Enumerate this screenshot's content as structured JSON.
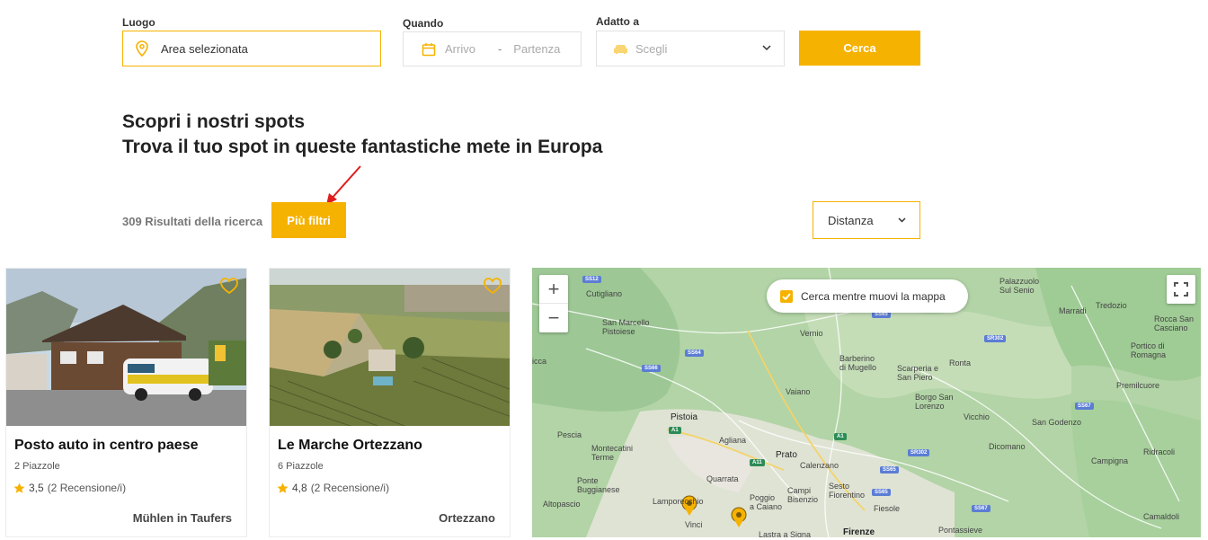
{
  "search": {
    "place_label": "Luogo",
    "place_value": "Area selezionata",
    "when_label": "Quando",
    "arrival_placeholder": "Arrivo",
    "separator": "-",
    "departure_placeholder": "Partenza",
    "suited_label": "Adatto a",
    "suited_value": "Scegli",
    "search_button": "Cerca"
  },
  "heading": {
    "line1": "Scopri i nostri spots",
    "line2": "Trova il tuo spot in queste fantastiche mete in Europa"
  },
  "results": {
    "count_text": "309 Risultati della ricerca",
    "filters_button": "Più filtri",
    "sort_value": "Distanza"
  },
  "cards": [
    {
      "location": "Mühlen in Taufers",
      "title": "Posto auto in centro paese",
      "pitches": "2 Piazzole",
      "rating": "3,5",
      "reviews": "(2 Recensione/i)"
    },
    {
      "location": "Ortezzano",
      "title": "Le Marche Ortezzano",
      "pitches": "6 Piazzole",
      "rating": "4,8",
      "reviews": "(2 Recensione/i)"
    }
  ],
  "map": {
    "zoom_in": "+",
    "zoom_out": "−",
    "move_search_label": "Cerca mentre muovi la mappa",
    "labels": {
      "cutigliano": "Cutigliano",
      "san_marcello": "San Marcello\nPistoiese",
      "vernio": "Vernio",
      "barberino": "Barberino\ndi Mugello",
      "scarperia": "Scarperia e\nSan Piero",
      "borgo": "Borgo San\nLorenzo",
      "vaiano": "Vaiano",
      "pistoia": "Pistoia",
      "agliana": "Agliana",
      "prato": "Prato",
      "calenzano": "Calenzano",
      "montecatini": "Montecatini\nTerme",
      "pescia": "Pescia",
      "quarrata": "Quarrata",
      "ponte": "Ponte\nBuggianese",
      "lamporecchio": "Lamporecchio",
      "poggio": "Poggio\na Caiano",
      "campi": "Campi\nBisenzio",
      "sesto": "Sesto\nFiorentino",
      "fiesole": "Fiesole",
      "altopascio": "Altopascio",
      "vinci": "Vinci",
      "firenze": "Firenze",
      "palazzuolo": "Palazzuolo\nSul Senio",
      "marradi": "Marradi",
      "tredozio": "Tredozio",
      "rocca": "Rocca San\nCasciano",
      "portico": "Portico di\nRomagna",
      "ronta": "Ronta",
      "vicchio": "Vicchio",
      "dicomano": "Dicomano",
      "san_godenzo": "San Godenzo",
      "premilcuore": "Premilcuore",
      "ridracoli": "Ridracoli",
      "campigna": "Campigna",
      "pontassieve": "Pontassieve",
      "camaldoli": "Camaldoli",
      "lucca_edge": "icca",
      "lastra": "Lastra a Signa",
      "ssi": "SS12",
      "ss64": "SS64",
      "ss66": "SS66",
      "a1": "A1",
      "a11": "A11",
      "ss65": "SS65",
      "sr302": "SR302",
      "ss67": "SS67"
    }
  }
}
